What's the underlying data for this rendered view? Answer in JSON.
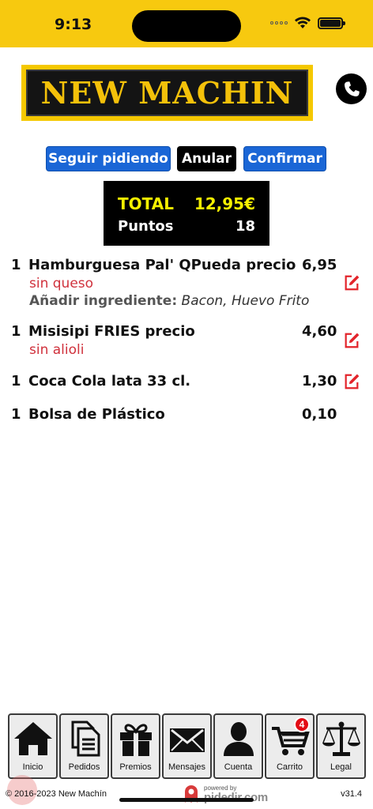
{
  "status_bar": {
    "time": "9:13"
  },
  "header": {
    "logo_text": "NEW MACHIN"
  },
  "actions": {
    "seguir_label": "Seguir pidiendo",
    "anular_label": "Anular",
    "confirmar_label": "Confirmar"
  },
  "totals": {
    "total_label": "TOTAL",
    "total_value": "12,95€",
    "points_label": "Puntos",
    "points_value": "18"
  },
  "items": [
    {
      "qty": "1",
      "name": "Hamburguesa Pal' QPueda precio",
      "price": "6,95",
      "mods": [
        "sin queso"
      ],
      "extra_label": "Añadir ingrediente:",
      "extra_value": " Bacon, Huevo Frito",
      "editable": true
    },
    {
      "qty": "1",
      "name": "Misisipi FRIES precio",
      "price": "4,60",
      "mods": [
        "sin alioli"
      ],
      "editable": true
    },
    {
      "qty": "1",
      "name": "Coca Cola lata 33 cl.",
      "price": "1,30",
      "editable": true
    },
    {
      "qty": "1",
      "name": "Bolsa de Plástico",
      "price": "0,10",
      "editable": false
    }
  ],
  "tabs": [
    {
      "label": "Inicio",
      "icon": "home-icon"
    },
    {
      "label": "Pedidos",
      "icon": "documents-icon"
    },
    {
      "label": "Premios",
      "icon": "gift-icon"
    },
    {
      "label": "Mensajes",
      "icon": "envelope-icon"
    },
    {
      "label": "Cuenta",
      "icon": "user-icon"
    },
    {
      "label": "Carrito",
      "icon": "cart-icon",
      "badge": "4"
    },
    {
      "label": "Legal",
      "icon": "scales-icon"
    }
  ],
  "footer": {
    "copyright": "© 2016-2023  New Machín",
    "powered_top": "powered by",
    "powered_brand": "pidedir.com",
    "version": "v31.4"
  },
  "colors": {
    "status_bar": "#f7c90f",
    "accent_blue": "#1a66d6",
    "modifier_red": "#d0313c",
    "total_yellow": "#f5f000"
  }
}
